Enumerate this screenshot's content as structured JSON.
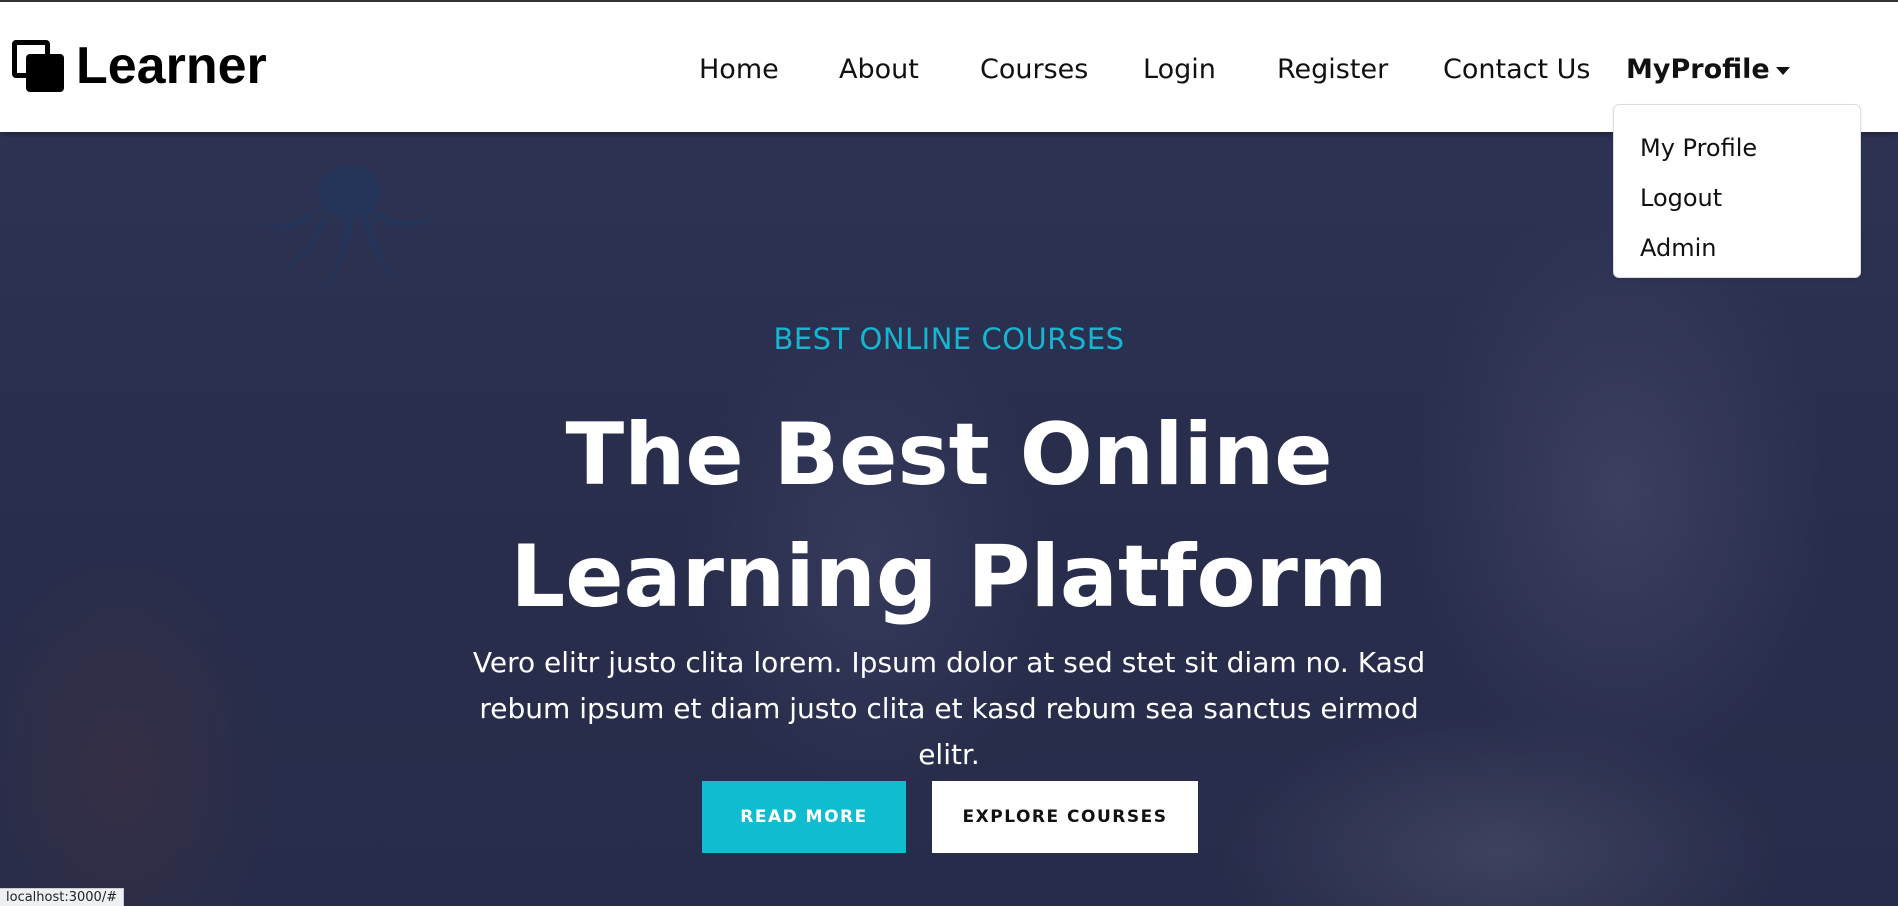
{
  "brand": {
    "name": "Learner"
  },
  "nav": {
    "items": [
      {
        "label": "Home"
      },
      {
        "label": "About"
      },
      {
        "label": "Courses"
      },
      {
        "label": "Login"
      },
      {
        "label": "Register"
      },
      {
        "label": "Contact Us"
      }
    ],
    "profile_label": "MyProfile"
  },
  "dropdown": {
    "items": [
      {
        "label": "My Profile"
      },
      {
        "label": "Logout"
      },
      {
        "label": "Admin"
      }
    ]
  },
  "hero": {
    "subtitle": "BEST ONLINE COURSES",
    "headline_line1": "The Best Online",
    "headline_line2": "Learning Platform",
    "description": "Vero elitr justo clita lorem. Ipsum dolor at sed stet sit diam no. Kasd rebum ipsum et diam justo clita et kasd rebum sea sanctus eirmod elitr.",
    "read_more_label": "READ MORE",
    "explore_label": "EXPLORE COURSES"
  },
  "status_bar": {
    "url": "localhost:3000/#"
  },
  "colors": {
    "accent": "#0fbcd0",
    "hero_overlay": "#181d38",
    "text_dark": "#111111",
    "text_light": "#ffffff"
  },
  "icons": {
    "brand": "stacked-squares-icon",
    "profile_caret": "caret-down-icon"
  }
}
